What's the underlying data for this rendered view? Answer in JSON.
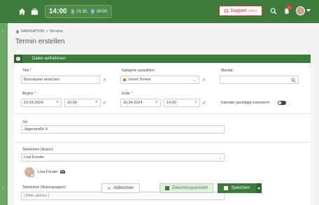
{
  "header": {
    "clock_time": "14:00",
    "clock_a": "01:35",
    "clock_b": "00:00",
    "support_label": "Support",
    "support_suffix": "(aktiv)",
    "notification_count": "1"
  },
  "breadcrumb": {
    "section": "NAVIGATION",
    "page": "Termine"
  },
  "page_title": "Termin erstellen",
  "panel": {
    "title": "Daten aufnehmen"
  },
  "form": {
    "titel_label": "Titel",
    "titel_value": "Büroräume streichen",
    "kategorie_label": "Kategorie auswählen",
    "kategorie_value": "Vorort Termin",
    "mandat_label": "Mandat",
    "beginn_label": "Beginn",
    "beginn_date": "10.04.2024",
    "beginn_time": "10:00",
    "ende_label": "Ende",
    "ende_date": "10.04.2024",
    "ende_time": "14:00",
    "ganztaegig_label": "Kalender ganztägig reservieren",
    "ort_label": "Ort",
    "ort_value": "Jägerstraße 4",
    "teilnehmer_label": "Teilnehmer (Nutzer)",
    "teilnehmer_value": "Lisa Forster",
    "teilnehmer_chip": "Lisa Forster",
    "gruppen_label": "Teilnehmer (Nutzergruppen)",
    "gruppen_placeholder": "[ Bitte wählen ]"
  },
  "buttons": {
    "cancel": "Abbrechen",
    "intermediate_save": "Zwischenspeichern",
    "save": "Speichern"
  },
  "colors": {
    "primary": "#3d7a3c",
    "support": "#c8102e"
  }
}
